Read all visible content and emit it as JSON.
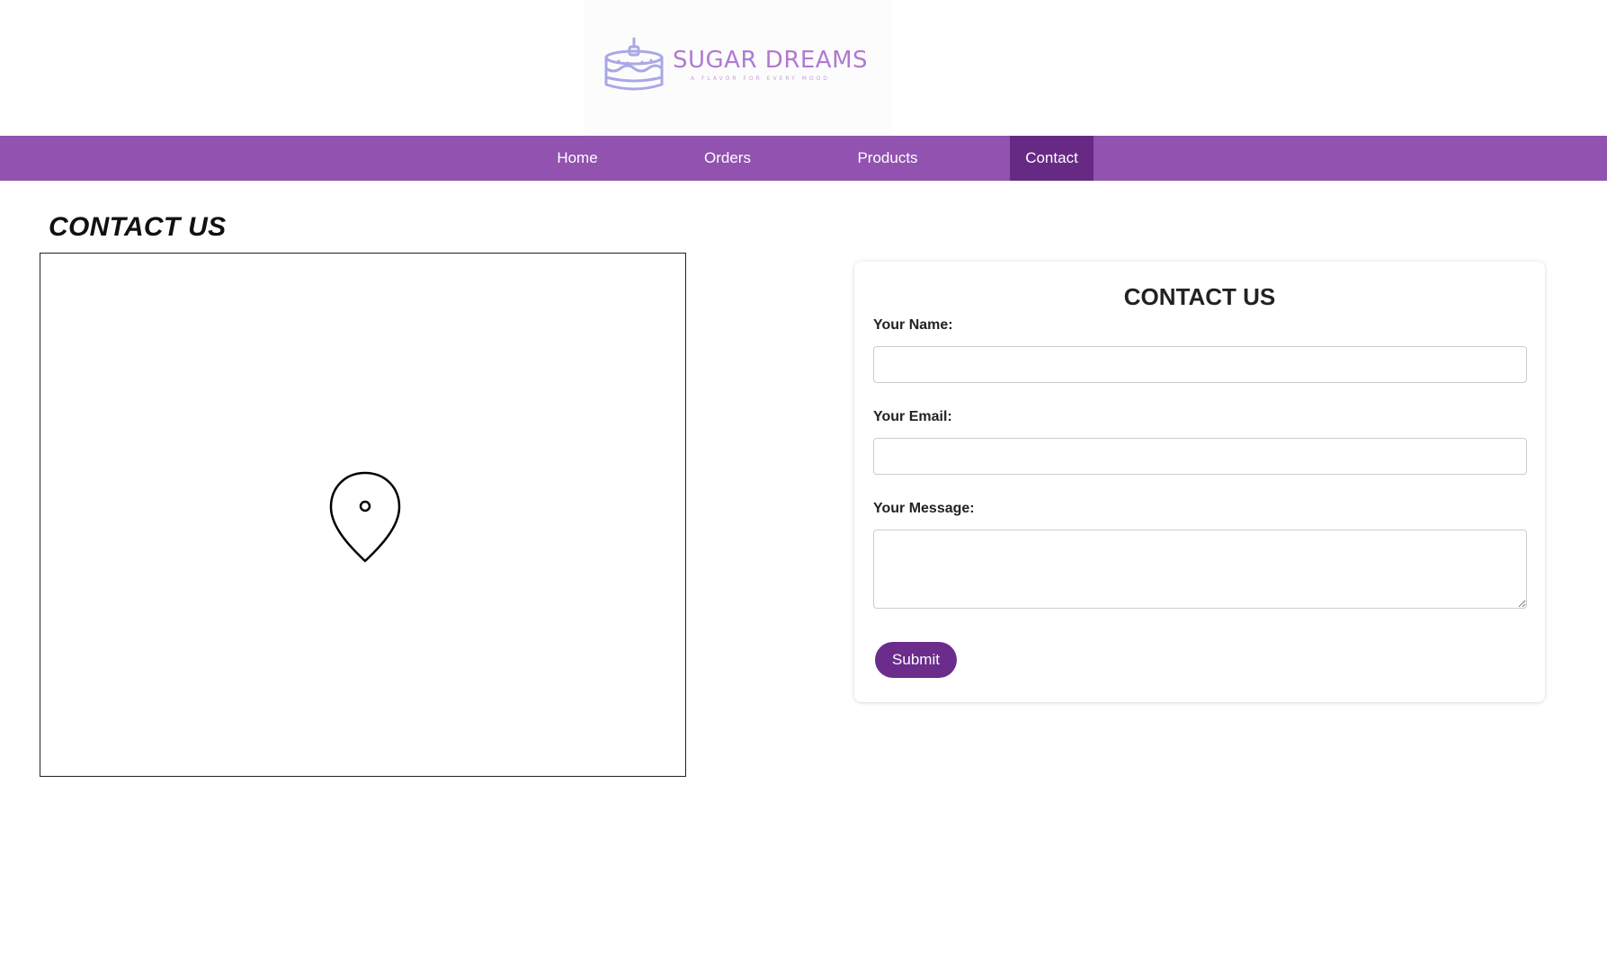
{
  "brand": {
    "name": "SUGAR DREAMS",
    "tagline": "A FLAVOR FOR EVERY MOOD",
    "logo_icon": "cake-icon",
    "colors": {
      "logo_cake": "#a9a8e6",
      "logo_text": "#b07ad1"
    }
  },
  "nav": {
    "items": [
      {
        "label": "Home",
        "active": false
      },
      {
        "label": "Orders",
        "active": false
      },
      {
        "label": "Products",
        "active": false
      },
      {
        "label": "Contact",
        "active": true
      }
    ],
    "colors": {
      "bar": "#9152b0",
      "active": "#672a84",
      "text": "#ffffff"
    }
  },
  "page": {
    "title": "CONTACT US"
  },
  "map": {
    "icon": "map-pin-icon"
  },
  "form": {
    "title": "CONTACT US",
    "name_label": "Your Name:",
    "name_value": "",
    "email_label": "Your Email:",
    "email_value": "",
    "message_label": "Your Message:",
    "message_value": "",
    "submit_label": "Submit",
    "submit_color": "#6b2c8c"
  }
}
